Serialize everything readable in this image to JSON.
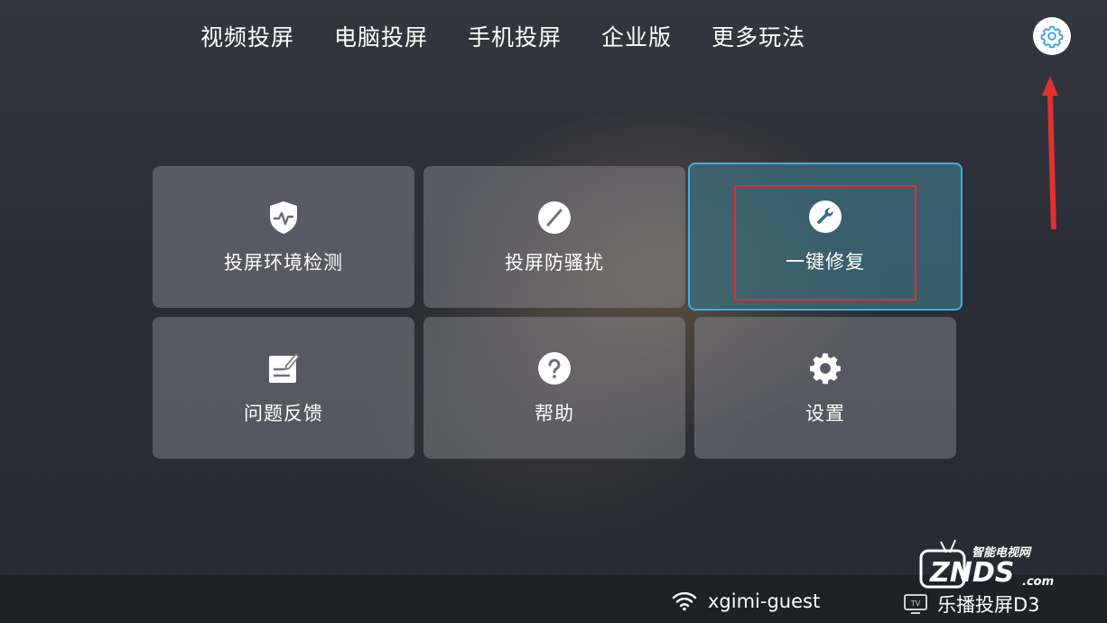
{
  "top_nav": {
    "items": [
      "视频投屏",
      "电脑投屏",
      "手机投屏",
      "企业版",
      "更多玩法"
    ]
  },
  "header": {
    "settings_icon": "gear-icon",
    "accent_color": "#2a9fe0"
  },
  "tiles": [
    {
      "label": "投屏环境检测",
      "icon": "shield-check-icon"
    },
    {
      "label": "投屏防骚扰",
      "icon": "block-icon"
    },
    {
      "label": "一键修复",
      "icon": "wrench-icon",
      "selected": true
    },
    {
      "label": "问题反馈",
      "icon": "feedback-edit-icon"
    },
    {
      "label": "帮助",
      "icon": "help-icon"
    },
    {
      "label": "设置",
      "icon": "gear-icon"
    }
  ],
  "status_bar": {
    "wifi_name": "xgimi-guest",
    "device_name": "乐播投屏D3"
  },
  "watermark": {
    "brand": "ZNDS",
    "tagline": "智能电视网",
    "suffix": ".com"
  },
  "colors": {
    "selected_border": "#3bb0e0",
    "annotation_red": "#e03030"
  }
}
